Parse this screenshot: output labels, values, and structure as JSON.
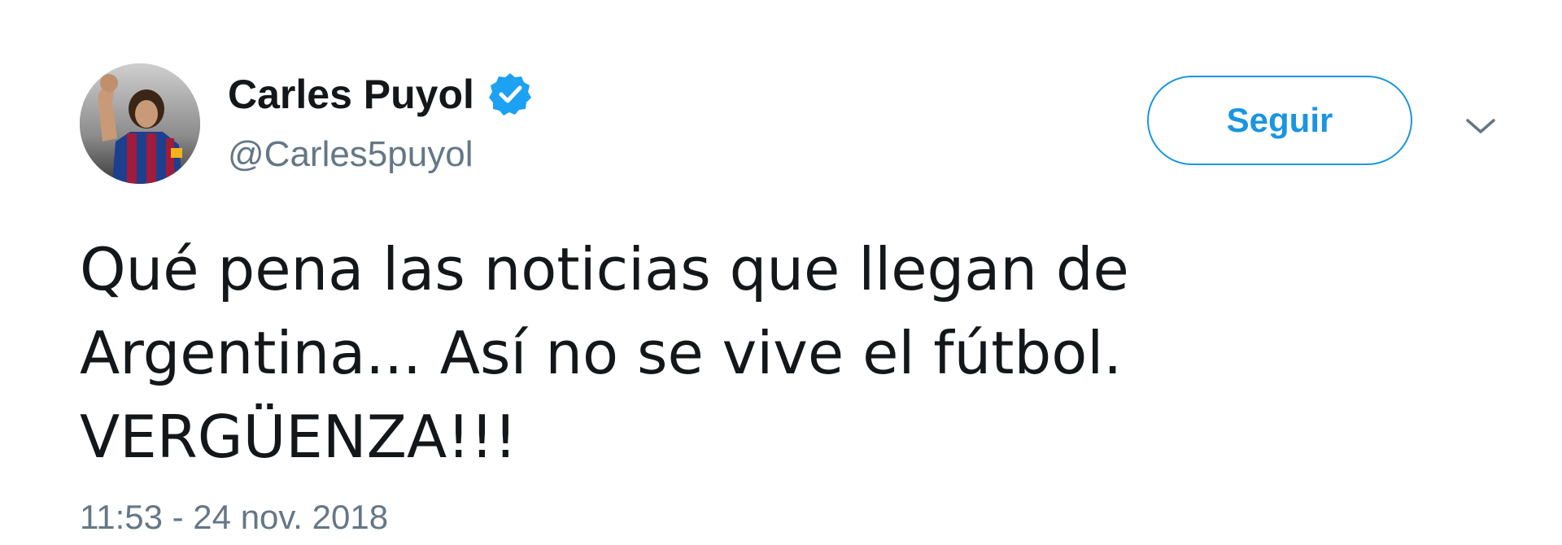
{
  "tweet": {
    "author": {
      "name": "Carles Puyol",
      "handle": "@Carles5puyol",
      "verified": true,
      "avatar_icon": "profile-photo"
    },
    "follow_label": "Seguir",
    "menu_icon": "chevron-down-icon",
    "text": "Qué pena las noticias que llegan de\nArgentina... Así no se vive el fútbol.\nVERGÜENZA!!!",
    "timestamp": "11:53 - 24 nov. 2018"
  },
  "colors": {
    "accent": "#1b95e0",
    "verified_badge": "#1da1f2",
    "secondary_text": "#657786",
    "primary_text": "#14171a"
  }
}
